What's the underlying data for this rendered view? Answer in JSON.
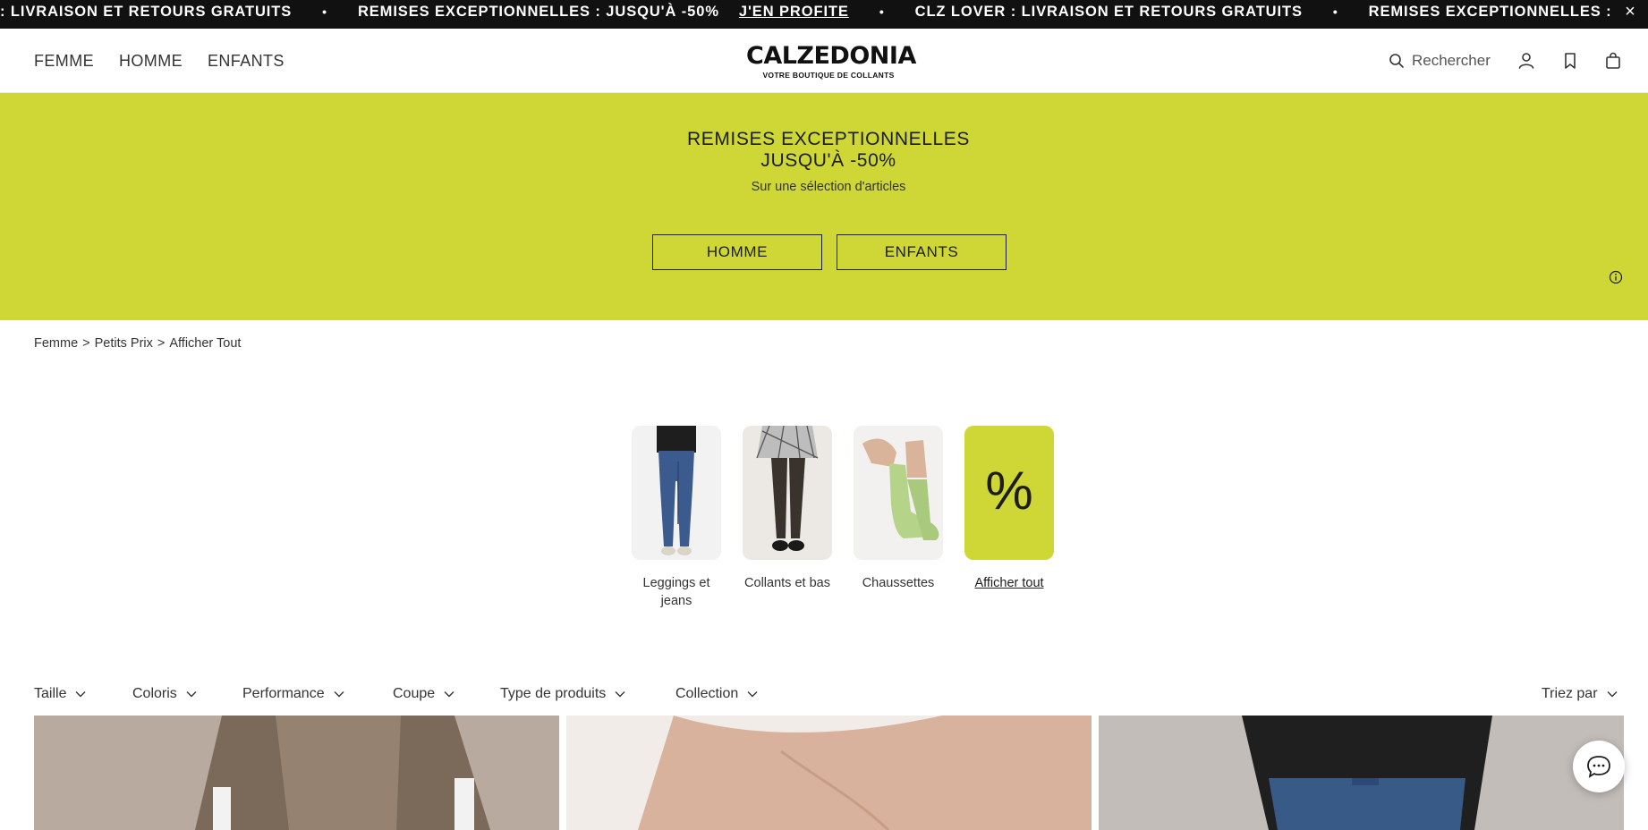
{
  "announcement": {
    "segments": [
      ": LIVRAISON ET RETOURS GRATUITS",
      "REMISES EXCEPTIONNELLES : JUSQU'À -50%",
      "CLZ LOVER : LIVRAISON ET RETOURS GRATUITS",
      "REMISES EXCEPTIONNELLES : "
    ],
    "separator": "•",
    "cta": "J'EN PROFITE",
    "close_icon": "×"
  },
  "header": {
    "nav": [
      "FEMME",
      "HOMME",
      "ENFANTS"
    ],
    "logo": "CALZEDONIA",
    "logo_tagline": "VOTRE BOUTIQUE DE COLLANTS",
    "search_label": "Rechercher",
    "icons": [
      "search-icon",
      "account-icon",
      "wishlist-icon",
      "bag-icon"
    ]
  },
  "promo": {
    "title_line1": "REMISES EXCEPTIONNELLES",
    "title_line2": "JUSQU'À -50%",
    "subtitle": "Sur une sélection d'articles",
    "buttons": [
      "HOMME",
      "ENFANTS"
    ],
    "background_color": "#cfd736"
  },
  "breadcrumb": [
    "Femme",
    "Petits Prix",
    "Afficher Tout"
  ],
  "breadcrumb_separator": ">",
  "categories": [
    {
      "label": "Leggings et jeans"
    },
    {
      "label": "Collants et bas"
    },
    {
      "label": "Chaussettes"
    },
    {
      "label": "Afficher tout",
      "symbol": "%"
    }
  ],
  "filters": [
    "Taille",
    "Coloris",
    "Performance",
    "Coupe",
    "Type de produits",
    "Collection"
  ],
  "sort_label": "Triez par"
}
